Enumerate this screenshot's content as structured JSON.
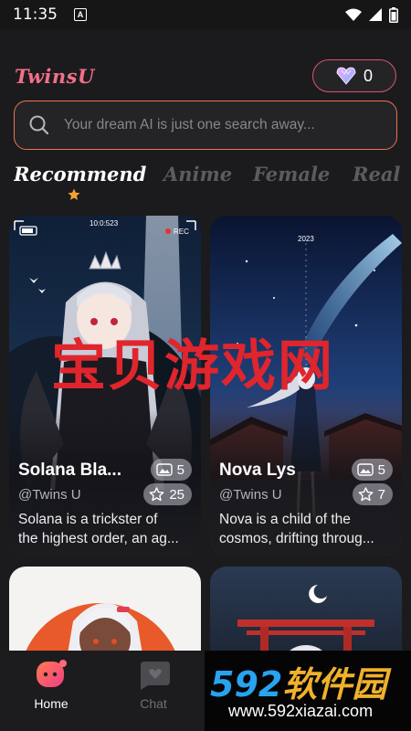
{
  "status_bar": {
    "time": "11:35",
    "notification_letter": "A"
  },
  "header": {
    "app_name": "TwinsU",
    "gem_count": "0"
  },
  "search": {
    "placeholder": "Your dream AI is just one search away..."
  },
  "tabs": [
    {
      "label": "Recommend",
      "active": true
    },
    {
      "label": "Anime",
      "active": false
    },
    {
      "label": "Female",
      "active": false
    },
    {
      "label": "Real",
      "active": false
    }
  ],
  "cards": [
    {
      "name": "Solana Bla...",
      "handle": "@Twins U",
      "desc_line1": "Solana is a trickster of",
      "desc_line2": "the highest order, an ag...",
      "image_count": "5",
      "like_count": "25",
      "overlay_timer": "10:0:523",
      "overlay_rec": "REC"
    },
    {
      "name": "Nova Lys",
      "handle": "@Twins U",
      "desc_line1": "Nova is a child of the",
      "desc_line2": "cosmos, drifting throug...",
      "image_count": "5",
      "like_count": "7",
      "overlay_text": "2023"
    }
  ],
  "bottom_nav": [
    {
      "label": "Home",
      "active": true
    },
    {
      "label": "Chat",
      "active": false
    }
  ],
  "watermark": {
    "chinese": "宝贝游戏网",
    "brand_number": "592",
    "brand_cn": "软件园",
    "url": "www.592xiazai.com"
  },
  "colors": {
    "accent_pink": "#f36f8a",
    "accent_orange": "#e8754e",
    "background": "#1b1b1d",
    "star": "#f2a32f"
  }
}
